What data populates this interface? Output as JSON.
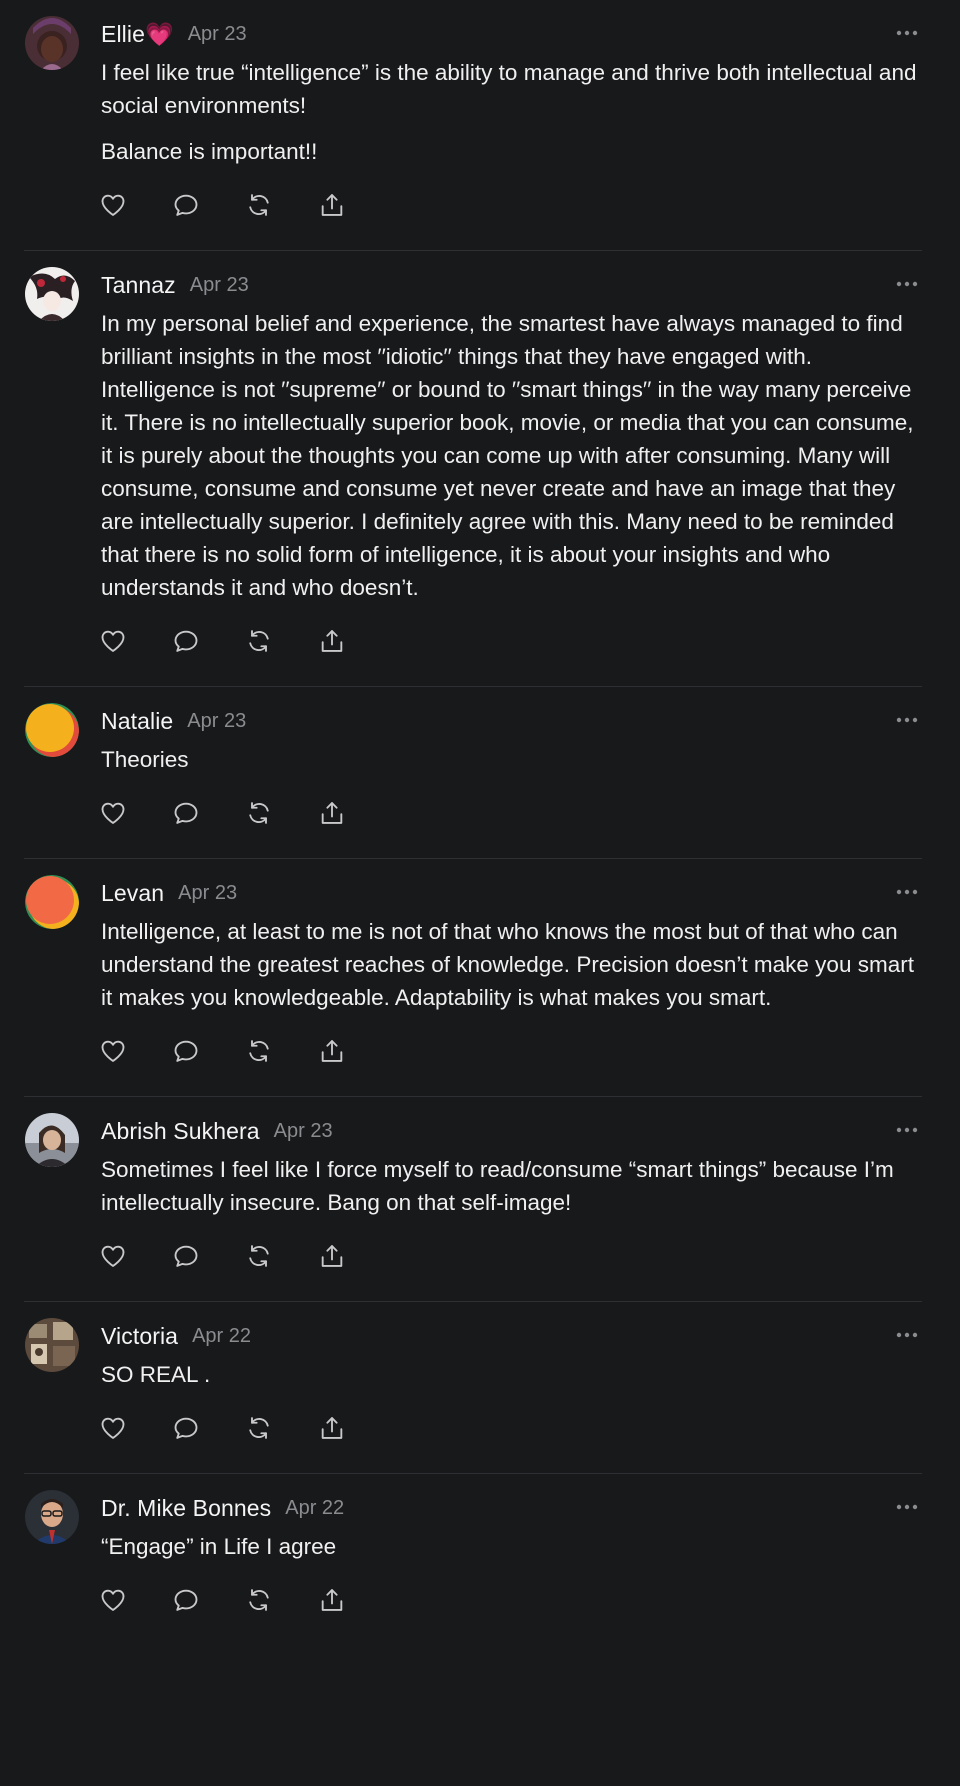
{
  "posts": [
    {
      "author": "Ellie💗",
      "date": "Apr 23",
      "avatar": "avatar-photo",
      "paragraphs": [
        "I feel like true “intelligence” is the ability to manage and thrive both intellectual and social environments!",
        "Balance is important!!"
      ]
    },
    {
      "author": "Tannaz",
      "date": "Apr 23",
      "avatar": "avatar-illustration",
      "paragraphs": [
        "In my personal belief and experience, the smartest have always managed to find brilliant insights in the most ′′idiotic′′ things that they have engaged with. Intelligence is not ′′supreme′′ or bound to ′′smart things′′ in the way many perceive it. There is no intellectually superior book, movie, or media that you can consume, it is purely about the thoughts you can come up with after consuming. Many will consume, consume and consume yet never create and have an image that they are intellectually superior. I definitely agree with this. Many need to be reminded that there is no solid form of intelligence, it is about your insights and who understands it and who doesn’t."
      ]
    },
    {
      "author": "Natalie",
      "date": "Apr 23",
      "avatar": "avatar-default-orange",
      "paragraphs": [
        "Theories"
      ]
    },
    {
      "author": "Levan",
      "date": "Apr 23",
      "avatar": "avatar-default-red",
      "paragraphs": [
        "Intelligence, at least to me is not of that who knows the most but of that who can understand the greatest reaches of knowledge. Precision doesn’t make you smart it makes you knowledgeable. Adaptability is what makes you smart."
      ]
    },
    {
      "author": "Abrish Sukhera",
      "date": "Apr 23",
      "avatar": "avatar-photo",
      "paragraphs": [
        "Sometimes I feel like I force myself to read/consume “smart things” because I’m intellectually insecure. Bang on that self-image!"
      ]
    },
    {
      "author": "Victoria",
      "date": "Apr 22",
      "avatar": "avatar-photo",
      "paragraphs": [
        "SO REAL ."
      ]
    },
    {
      "author": "Dr. Mike Bonnes",
      "date": "Apr 22",
      "avatar": "avatar-photo",
      "paragraphs": [
        "“Engage” in Life I agree"
      ]
    }
  ],
  "icons": {
    "more": "more-horizontal-icon",
    "like": "heart-icon",
    "reply": "comment-icon",
    "repost": "repost-icon",
    "share": "share-icon"
  },
  "colors": {
    "background": "#18191b",
    "text": "#f2f2f2",
    "muted": "#8b8c8f",
    "divider": "#2e2f32",
    "icon": "#c9c9cb"
  }
}
